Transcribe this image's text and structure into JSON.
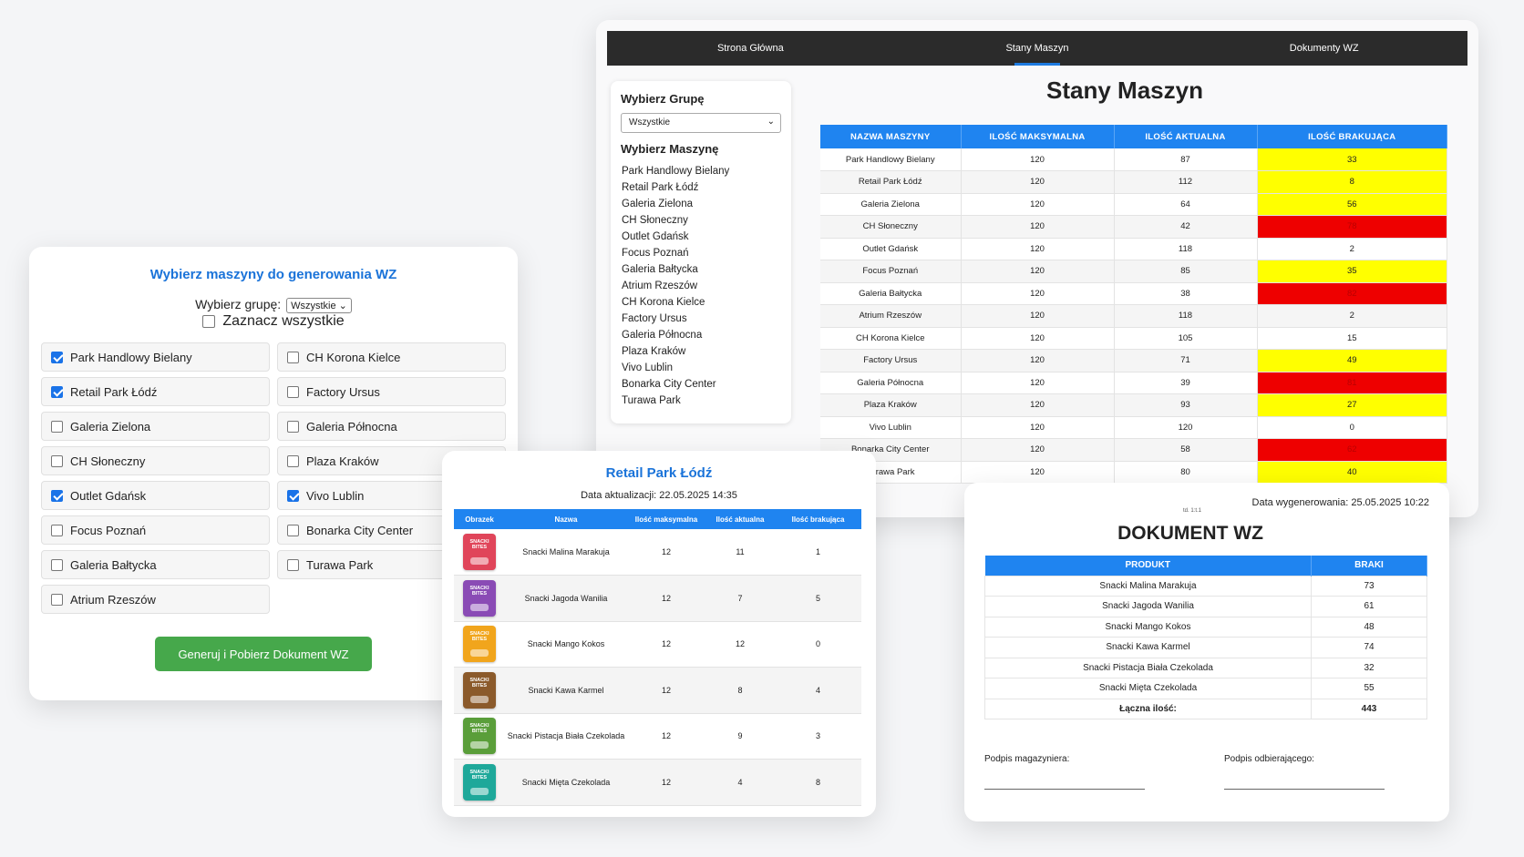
{
  "stany": {
    "nav": [
      "Strona Główna",
      "Stany Maszyn",
      "Dokumenty WZ"
    ],
    "nav_active": 1,
    "sidebar": {
      "group_heading": "Wybierz Grupę",
      "group_value": "Wszystkie",
      "machine_heading": "Wybierz Maszynę",
      "machines": [
        "Park Handlowy Bielany",
        "Retail Park Łódź",
        "Galeria Zielona",
        "CH Słoneczny",
        "Outlet Gdańsk",
        "Focus Poznań",
        "Galeria Bałtycka",
        "Atrium Rzeszów",
        "CH Korona Kielce",
        "Factory Ursus",
        "Galeria Północna",
        "Plaza Kraków",
        "Vivo Lublin",
        "Bonarka City Center",
        "Turawa Park"
      ]
    },
    "title": "Stany Maszyn",
    "columns": [
      "Nazwa maszyny",
      "Ilość maksymalna",
      "Ilość aktualna",
      "Ilość brakująca"
    ],
    "rows": [
      {
        "name": "Park Handlowy Bielany",
        "max": "120",
        "current": "87",
        "missing": "33",
        "level": "yellow"
      },
      {
        "name": "Retail Park Łódź",
        "max": "120",
        "current": "112",
        "missing": "8",
        "level": "yellow"
      },
      {
        "name": "Galeria Zielona",
        "max": "120",
        "current": "64",
        "missing": "56",
        "level": "yellow"
      },
      {
        "name": "CH Słoneczny",
        "max": "120",
        "current": "42",
        "missing": "78",
        "level": "red"
      },
      {
        "name": "Outlet Gdańsk",
        "max": "120",
        "current": "118",
        "missing": "2",
        "level": "none"
      },
      {
        "name": "Focus Poznań",
        "max": "120",
        "current": "85",
        "missing": "35",
        "level": "yellow"
      },
      {
        "name": "Galeria Bałtycka",
        "max": "120",
        "current": "38",
        "missing": "82",
        "level": "red"
      },
      {
        "name": "Atrium Rzeszów",
        "max": "120",
        "current": "118",
        "missing": "2",
        "level": "none"
      },
      {
        "name": "CH Korona Kielce",
        "max": "120",
        "current": "105",
        "missing": "15",
        "level": "none"
      },
      {
        "name": "Factory Ursus",
        "max": "120",
        "current": "71",
        "missing": "49",
        "level": "yellow"
      },
      {
        "name": "Galeria Północna",
        "max": "120",
        "current": "39",
        "missing": "81",
        "level": "red"
      },
      {
        "name": "Plaza Kraków",
        "max": "120",
        "current": "93",
        "missing": "27",
        "level": "yellow"
      },
      {
        "name": "Vivo Lublin",
        "max": "120",
        "current": "120",
        "missing": "0",
        "level": "none"
      },
      {
        "name": "Bonarka City Center",
        "max": "120",
        "current": "58",
        "missing": "62",
        "level": "red"
      },
      {
        "name": "Turawa Park",
        "max": "120",
        "current": "80",
        "missing": "40",
        "level": "yellow"
      }
    ]
  },
  "wz_select": {
    "title": "Wybierz maszyny do generowania WZ",
    "group_label": "Wybierz grupę:",
    "group_value": "Wszystkie",
    "select_all_label": "Zaznacz wszystkie",
    "machines": [
      {
        "label": "Park Handlowy Bielany",
        "checked": true
      },
      {
        "label": "CH Korona Kielce",
        "checked": false
      },
      {
        "label": "Retail Park Łódź",
        "checked": true
      },
      {
        "label": "Factory Ursus",
        "checked": false
      },
      {
        "label": "Galeria Zielona",
        "checked": false
      },
      {
        "label": "Galeria Północna",
        "checked": false
      },
      {
        "label": "CH Słoneczny",
        "checked": false
      },
      {
        "label": "Plaza Kraków",
        "checked": false
      },
      {
        "label": "Outlet Gdańsk",
        "checked": true
      },
      {
        "label": "Vivo Lublin",
        "checked": true
      },
      {
        "label": "Focus Poznań",
        "checked": false
      },
      {
        "label": "Bonarka City Center",
        "checked": false
      },
      {
        "label": "Galeria Bałtycka",
        "checked": false
      },
      {
        "label": "Turawa Park",
        "checked": false
      },
      {
        "label": "Atrium Rzeszów",
        "checked": false
      }
    ],
    "button_label": "Generuj i Pobierz Dokument WZ"
  },
  "retail": {
    "title": "Retail Park Łódź",
    "updated": "Data aktualizacji: 22.05.2025 14:35",
    "columns": [
      "Obrazek",
      "Nazwa",
      "Ilość maksymalna",
      "Ilość aktualna",
      "Ilość brakująca"
    ],
    "rows": [
      {
        "name": "Snacki Malina Marakuja",
        "max": "12",
        "current": "11",
        "missing": "1",
        "color": "#e0455a",
        "pack_text": "SNACKI BITES"
      },
      {
        "name": "Snacki Jagoda Wanilia",
        "max": "12",
        "current": "7",
        "missing": "5",
        "color": "#8a4bb5",
        "pack_text": "SNACKI BITES"
      },
      {
        "name": "Snacki Mango Kokos",
        "max": "12",
        "current": "12",
        "missing": "0",
        "color": "#f1a51c",
        "pack_text": "SNACKI BITES"
      },
      {
        "name": "Snacki Kawa Karmel",
        "max": "12",
        "current": "8",
        "missing": "4",
        "color": "#8b5a2b",
        "pack_text": "SNACKI BITES"
      },
      {
        "name": "Snacki Pistacja Biała Czekolada",
        "max": "12",
        "current": "9",
        "missing": "3",
        "color": "#5a9e3a",
        "pack_text": "SNACKI BITES"
      },
      {
        "name": "Snacki Mięta Czekolada",
        "max": "12",
        "current": "4",
        "missing": "8",
        "color": "#1ea89a",
        "pack_text": "SNACKI BITES"
      }
    ]
  },
  "dokument": {
    "generated": "Data wygenerowania: 25.05.2025 10:22",
    "small_note": "td. 1:t.1",
    "title": "DOKUMENT WZ",
    "columns": [
      "PRODUKT",
      "BRAKI"
    ],
    "rows": [
      {
        "product": "Snacki Malina Marakuja",
        "missing": "73"
      },
      {
        "product": "Snacki Jagoda Wanilia",
        "missing": "61"
      },
      {
        "product": "Snacki Mango Kokos",
        "missing": "48"
      },
      {
        "product": "Snacki Kawa Karmel",
        "missing": "74"
      },
      {
        "product": "Snacki Pistacja Biała Czekolada",
        "missing": "32"
      },
      {
        "product": "Snacki Mięta Czekolada",
        "missing": "55"
      }
    ],
    "total_label": "Łączna ilość:",
    "total_value": "443",
    "sig_left": "Podpis magazyniera:",
    "sig_right": "Podpis odbierającego:"
  }
}
